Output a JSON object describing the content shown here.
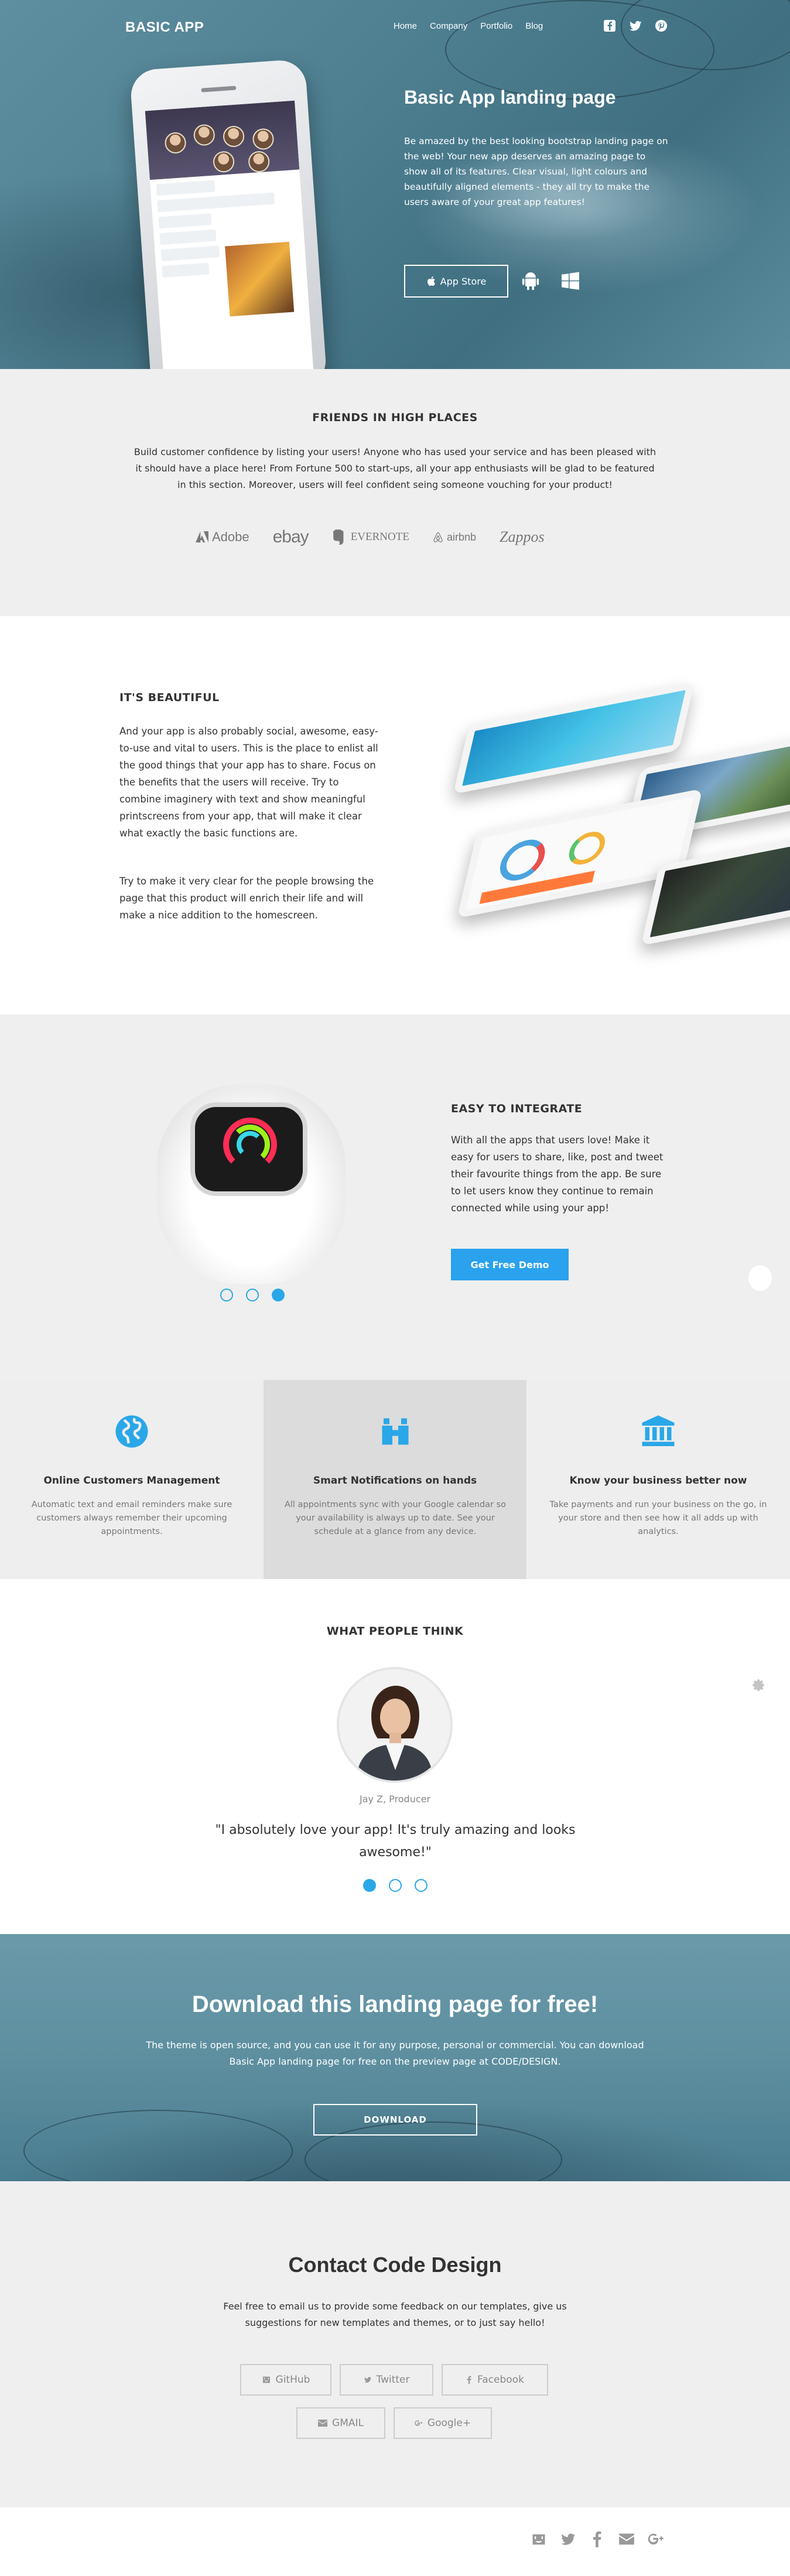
{
  "nav": {
    "brand": "BASIC APP",
    "links": [
      "Home",
      "Company",
      "Portfolio",
      "Blog"
    ],
    "icons": [
      "facebook-icon",
      "twitter-icon",
      "pinterest-icon"
    ]
  },
  "hero": {
    "title": "Basic App landing page",
    "text": "Be amazed by the best looking bootstrap landing page on the web! Your new app deserves an amazing page to show all of its features. Clear visual, light colours and beautifully aligned elements - they all try to make the users aware of your great app features!",
    "appstore_label": "App Store",
    "colors": {
      "overlay": "#4d7f91"
    }
  },
  "friends": {
    "title": "FRIENDS IN HIGH PLACES",
    "text": "Build customer confidence by listing your users! Anyone who has used your service and has been pleased with it should have a place here! From Fortune 500 to start-ups, all your app enthusiasts will be glad to be featured in this section. Moreover, users will feel confident seing someone vouching for your product!",
    "logos": [
      "Adobe",
      "ebay",
      "EVERNOTE",
      "airbnb",
      "Zappos"
    ]
  },
  "beautiful": {
    "title": "IT'S BEAUTIFUL",
    "p1": "And your app is also probably social, awesome, easy-to-use and vital to users. This is the place to enlist all the good things that your app has to share. Focus on the benefits that the users will receive. Try to combine imaginery with text and show meaningful printscreens from your app, that will make it clear what exactly the basic functions are.",
    "p2": "Try to make it very clear for the people browsing the page that this product will enrich their life and will make a nice addition to the homescreen."
  },
  "integrate": {
    "title": "EASY TO INTEGRATE",
    "text": "With all the apps that users love! Make it easy for users to share, like, post and tweet their favourite things from the app. Be sure to let users know they continue to remain connected while using your app!",
    "button": "Get Free Demo",
    "active_slide": 3,
    "slides": 3,
    "accent": "#2aa2ee"
  },
  "features": [
    {
      "icon": "globe-icon",
      "title": "Online Customers Management",
      "text": "Automatic text and email reminders make sure customers always remember their upcoming appointments."
    },
    {
      "icon": "binoculars-icon",
      "title": "Smart Notifications on hands",
      "text": "All appointments sync with your Google calendar so your availability is always up to date. See your schedule at a glance from any device."
    },
    {
      "icon": "bank-icon",
      "title": "Know your business better now",
      "text": "Take payments and run your business on the go, in your store and then see how it all adds up with analytics."
    }
  ],
  "testimonial": {
    "title": "WHAT PEOPLE THINK",
    "name": "Jay Z, Producer",
    "quote": "\"I absolutely love your app! It's truly amazing and looks awesome!\"",
    "active_slide": 1,
    "slides": 3
  },
  "download": {
    "title": "Download this landing page for free!",
    "text": "The theme is open source, and you can use it for any purpose, personal or commercial. You can download Basic App landing page for free on the preview page at CODE/DESIGN.",
    "button": "DOWNLOAD"
  },
  "contact": {
    "title": "Contact Code Design",
    "text": "Feel free to email us to provide some feedback on our templates, give us suggestions for new templates and themes, or to just say hello!",
    "buttons": [
      "GitHub",
      "Twitter",
      "Facebook",
      "GMAIL",
      "Google+"
    ]
  },
  "footer": {
    "icons": [
      "github-icon",
      "twitter-icon",
      "facebook-icon",
      "mail-icon",
      "google-plus-icon"
    ]
  }
}
